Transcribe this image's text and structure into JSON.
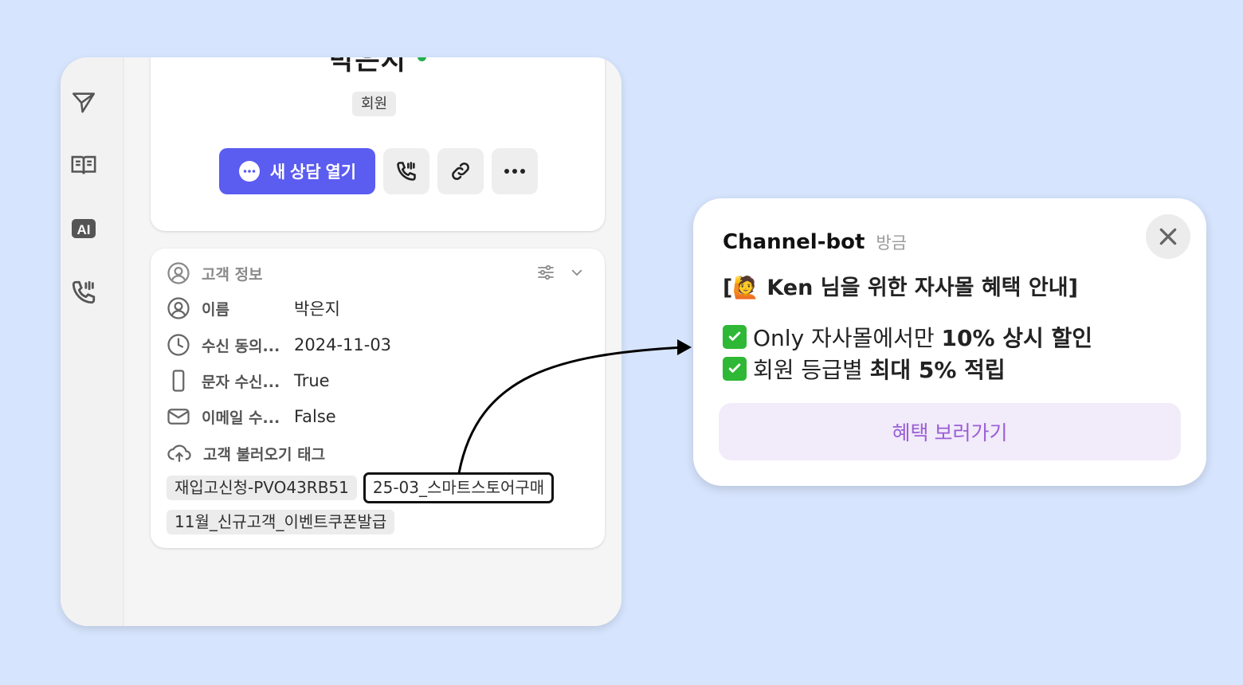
{
  "profile": {
    "name": "박은지",
    "badge": "회원",
    "primary_action": "새 상담 열기"
  },
  "info": {
    "header": "고객 정보",
    "rows": [
      {
        "label": "이름",
        "value": "박은지",
        "icon": "person-icon"
      },
      {
        "label": "수신 동의...",
        "value": "2024-11-03",
        "icon": "clock-icon"
      },
      {
        "label": "문자 수신...",
        "value": "True",
        "icon": "phone-icon"
      },
      {
        "label": "이메일 수...",
        "value": "False",
        "icon": "mail-icon"
      }
    ],
    "tag_header": "고객 불러오기 태그",
    "tags": [
      "재입고신청-PVO43RB51",
      "25-03_스마트스토어구매",
      "11월_신규고객_이벤트쿠폰발급"
    ]
  },
  "popup": {
    "sender": "Channel-bot",
    "time": "방금",
    "title": "[🙋 Ken 님을 위한 자사몰 혜택 안내]",
    "line1_prefix": "Only 자사몰에서만 ",
    "line1_bold": "10% 상시 할인",
    "line2_prefix": "회원 등급별 ",
    "line2_bold": "최대 5% 적립",
    "cta": "혜택 보러가기"
  },
  "colors": {
    "background": "#d6e4fd",
    "primary": "#5b5cf0",
    "online": "#22b14c",
    "cta_bg": "#f1ebfa",
    "cta_text": "#9b5fd6",
    "check": "#2eb835"
  }
}
